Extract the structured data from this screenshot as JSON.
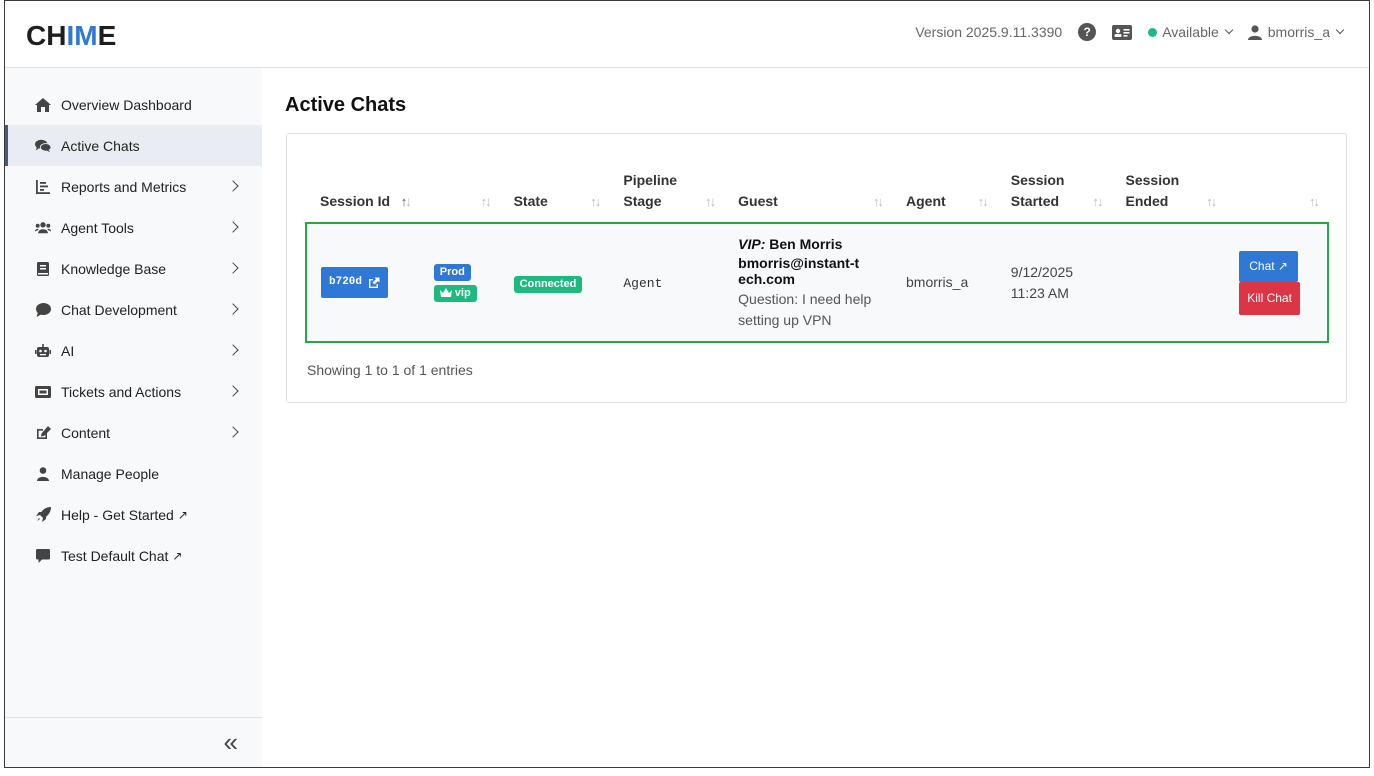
{
  "header": {
    "logo": {
      "pre": "CH",
      "mid": "IM",
      "post": "E"
    },
    "version": "Version 2025.9.11.3390",
    "status": "Available",
    "status_color": "#1db97f",
    "username": "bmorris_a"
  },
  "sidebar": {
    "items": [
      {
        "label": "Overview Dashboard",
        "icon": "home-icon",
        "arrow": false
      },
      {
        "label": "Active Chats",
        "icon": "comments-icon",
        "arrow": false,
        "active": true
      },
      {
        "label": "Reports and Metrics",
        "icon": "chart-icon",
        "arrow": true
      },
      {
        "label": "Agent Tools",
        "icon": "users-icon",
        "arrow": true
      },
      {
        "label": "Knowledge Base",
        "icon": "book-icon",
        "arrow": true
      },
      {
        "label": "Chat Development",
        "icon": "chat-bubble-icon",
        "arrow": true
      },
      {
        "label": "AI",
        "icon": "robot-icon",
        "arrow": true
      },
      {
        "label": "Tickets and Actions",
        "icon": "ticket-icon",
        "arrow": true
      },
      {
        "label": "Content",
        "icon": "edit-icon",
        "arrow": true
      },
      {
        "label": "Manage People",
        "icon": "user-icon",
        "arrow": false
      },
      {
        "label": "Help - Get Started",
        "icon": "rocket-icon",
        "arrow": false,
        "external": true
      },
      {
        "label": "Test Default Chat",
        "icon": "message-icon",
        "arrow": false,
        "external": true
      }
    ],
    "collapse_label": "«"
  },
  "main": {
    "title": "Active Chats",
    "table": {
      "headers": {
        "session_id": "Session Id",
        "state": "State",
        "pipeline_stage": "Pipeline Stage",
        "guest": "Guest",
        "agent": "Agent",
        "session_started": "Session Started",
        "session_ended": "Session Ended"
      },
      "row": {
        "session_id": "b720d",
        "badge_prod": "Prod",
        "badge_vip": "vip",
        "state": "Connected",
        "pipeline_stage": "Agent",
        "guest_vip": "VIP:",
        "guest_name": "Ben Morris",
        "guest_email": "bmorris@instant-tech.com",
        "guest_question": "Question: I need help setting up VPN",
        "agent": "bmorris_a",
        "started_date": "9/12/2025",
        "started_time": "11:23 AM",
        "ended": "",
        "chat_button": "Chat ↗",
        "kill_button": "Kill Chat"
      }
    },
    "entries": "Showing 1 to 1 of 1 entries"
  }
}
